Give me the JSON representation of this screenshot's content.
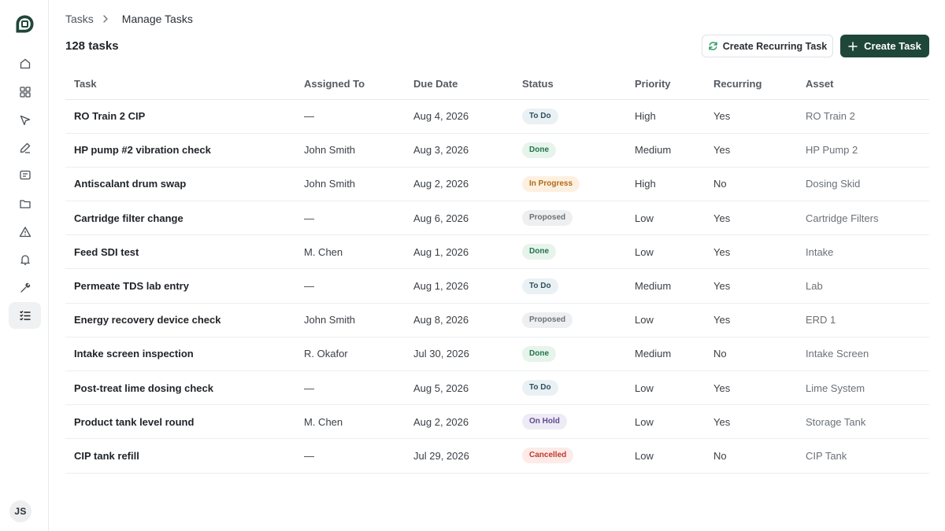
{
  "user": {
    "initials": "JS"
  },
  "breadcrumb": {
    "parent": "Tasks",
    "current": "Manage Tasks"
  },
  "summary": {
    "count_label": "128 tasks"
  },
  "actions": {
    "recurring_label": "Create Recurring Task",
    "create_label": "Create Task"
  },
  "colors": {
    "brand": "#1f4739",
    "active_nav_bg": "#eff1f3"
  },
  "sidebar": {
    "items": [
      {
        "icon": "home-icon",
        "active": false
      },
      {
        "icon": "dashboard-grid-icon",
        "active": false
      },
      {
        "icon": "navigation-arrow-icon",
        "active": false
      },
      {
        "icon": "pen-icon",
        "active": false
      },
      {
        "icon": "message-icon",
        "active": false
      },
      {
        "icon": "folder-icon",
        "active": false
      },
      {
        "icon": "warning-icon",
        "active": false
      },
      {
        "icon": "bell-icon",
        "active": false
      },
      {
        "icon": "wrench-icon",
        "active": false
      },
      {
        "icon": "task-list-icon",
        "active": true
      }
    ]
  },
  "table": {
    "columns": [
      "Task",
      "Assigned To",
      "Due Date",
      "Status",
      "Priority",
      "Recurring",
      "Asset"
    ],
    "rows": [
      {
        "task": "RO Train 2 CIP",
        "assigned": "—",
        "due": "Aug 4, 2026",
        "status": "To Do",
        "status_key": "todo",
        "priority": "High",
        "recurring": "Yes",
        "asset": "RO Train 2"
      },
      {
        "task": "HP pump #2 vibration check",
        "assigned": "John Smith",
        "due": "Aug 3, 2026",
        "status": "Done",
        "status_key": "done",
        "priority": "Medium",
        "recurring": "Yes",
        "asset": "HP Pump 2"
      },
      {
        "task": "Antiscalant drum swap",
        "assigned": "John Smith",
        "due": "Aug 2, 2026",
        "status": "In Progress",
        "status_key": "progress",
        "priority": "High",
        "recurring": "No",
        "asset": "Dosing Skid"
      },
      {
        "task": "Cartridge filter change",
        "assigned": "—",
        "due": "Aug 6, 2026",
        "status": "Proposed",
        "status_key": "proposed",
        "priority": "Low",
        "recurring": "Yes",
        "asset": "Cartridge Filters"
      },
      {
        "task": "Feed SDI test",
        "assigned": "M. Chen",
        "due": "Aug 1, 2026",
        "status": "Done",
        "status_key": "done",
        "priority": "Low",
        "recurring": "Yes",
        "asset": "Intake"
      },
      {
        "task": "Permeate TDS lab entry",
        "assigned": "—",
        "due": "Aug 1, 2026",
        "status": "To Do",
        "status_key": "todo",
        "priority": "Medium",
        "recurring": "Yes",
        "asset": "Lab"
      },
      {
        "task": "Energy recovery device check",
        "assigned": "John Smith",
        "due": "Aug 8, 2026",
        "status": "Proposed",
        "status_key": "proposed",
        "priority": "Low",
        "recurring": "Yes",
        "asset": "ERD 1"
      },
      {
        "task": "Intake screen inspection",
        "assigned": "R. Okafor",
        "due": "Jul 30, 2026",
        "status": "Done",
        "status_key": "done",
        "priority": "Medium",
        "recurring": "No",
        "asset": "Intake Screen"
      },
      {
        "task": "Post-treat lime dosing check",
        "assigned": "—",
        "due": "Aug 5, 2026",
        "status": "To Do",
        "status_key": "todo",
        "priority": "Low",
        "recurring": "Yes",
        "asset": "Lime System"
      },
      {
        "task": "Product tank level round",
        "assigned": "M. Chen",
        "due": "Aug 2, 2026",
        "status": "On Hold",
        "status_key": "hold",
        "priority": "Low",
        "recurring": "Yes",
        "asset": "Storage Tank"
      },
      {
        "task": "CIP tank refill",
        "assigned": "—",
        "due": "Jul 29, 2026",
        "status": "Cancelled",
        "status_key": "cancelled",
        "priority": "Low",
        "recurring": "No",
        "asset": "CIP Tank"
      }
    ]
  },
  "status_styles": {
    "todo": {
      "bg": "#eaf1f4",
      "fg": "#2f4f5d"
    },
    "done": {
      "bg": "#e6f4ec",
      "fg": "#23734a"
    },
    "progress": {
      "bg": "#fdf0e0",
      "fg": "#b06a16"
    },
    "proposed": {
      "bg": "#eeeff0",
      "fg": "#6d7277"
    },
    "hold": {
      "bg": "#eeebf6",
      "fg": "#5d4b8e"
    },
    "cancelled": {
      "bg": "#fcebe8",
      "fg": "#c0392b"
    }
  }
}
